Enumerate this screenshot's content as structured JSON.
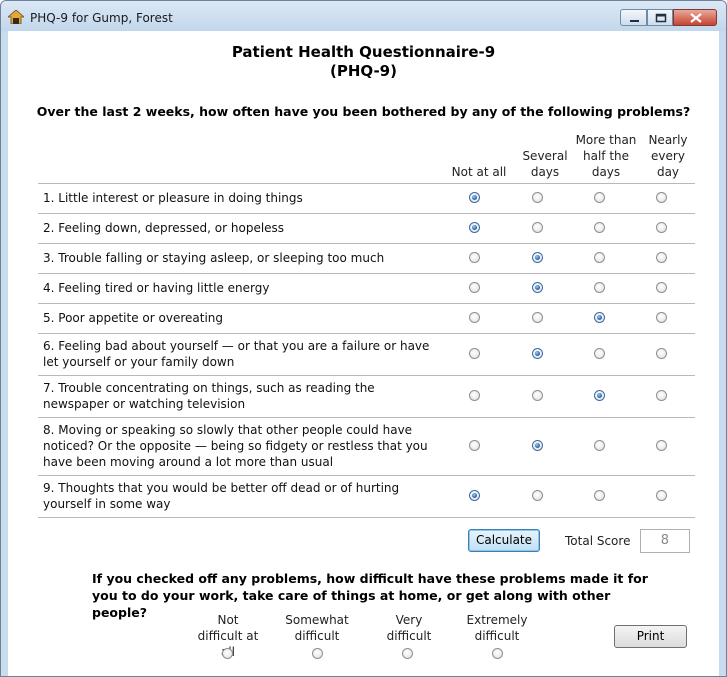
{
  "window": {
    "title": "PHQ-9 for Gump, Forest",
    "controls": [
      "minimize",
      "maximize",
      "close"
    ]
  },
  "header": {
    "title": "Patient Health Questionnaire-9",
    "subtitle": "(PHQ-9)"
  },
  "question": "Over the last 2 weeks, how often have you been bothered by any of the following problems?",
  "columns": [
    {
      "label": "Not at all"
    },
    {
      "label": "Several days"
    },
    {
      "label": "More than half the days"
    },
    {
      "label": "Nearly every day"
    }
  ],
  "items": [
    {
      "text": "1. Little interest or pleasure in doing things",
      "selected": 0
    },
    {
      "text": "2. Feeling down, depressed, or hopeless",
      "selected": 0
    },
    {
      "text": "3. Trouble falling or staying asleep, or sleeping too much",
      "selected": 1
    },
    {
      "text": "4. Feeling tired or having little energy",
      "selected": 1
    },
    {
      "text": "5. Poor appetite or overeating",
      "selected": 2
    },
    {
      "text": "6. Feeling bad about yourself — or that you are a failure or have let yourself or your family down",
      "selected": 1
    },
    {
      "text": "7. Trouble concentrating on things, such as reading the newspaper or watching television",
      "selected": 2
    },
    {
      "text": "8. Moving or speaking so slowly that other people could have noticed? Or the opposite — being so fidgety or restless that you have been moving around a lot more than usual",
      "selected": 1
    },
    {
      "text": "9. Thoughts that you would be better off dead or of hurting yourself in some way",
      "selected": 0
    }
  ],
  "calculate": {
    "label": "Calculate"
  },
  "total": {
    "label": "Total Score",
    "value": "8"
  },
  "difficulty": {
    "question": "If you checked off any problems, how difficult have these problems made it for you to do your work, take care of things at home, or get along with other people?",
    "options": [
      "Not difficult at all",
      "Somewhat difficult",
      "Very difficult",
      "Extremely difficult"
    ],
    "selected": null
  },
  "print": {
    "label": "Print"
  },
  "icons": {
    "app": "clipboard-icon"
  }
}
